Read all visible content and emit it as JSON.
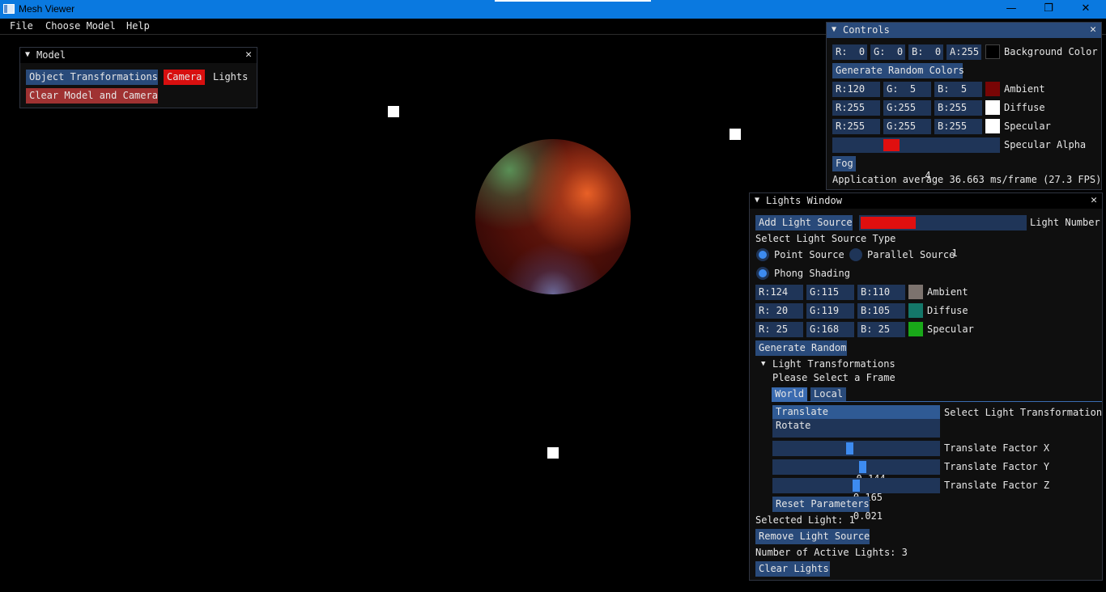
{
  "window": {
    "title": "Mesh Viewer",
    "minimize_glyph": "—",
    "maximize_glyph": "❐",
    "close_glyph": "✕"
  },
  "menu": [
    "File",
    "Choose Model",
    "Help"
  ],
  "model_window": {
    "title": "Model",
    "buttons": {
      "object_transformations": "Object Transformations",
      "camera": "Camera",
      "lights": "Lights",
      "clear": "Clear Model and Camera"
    }
  },
  "controls_window": {
    "title": "Controls",
    "background": {
      "r": "R:  0",
      "g": "G:  0",
      "b": "B:  0",
      "a": "A:255",
      "label": "Background Color",
      "color": "#000000"
    },
    "generate_random_colors": "Generate Random Colors",
    "ambient": {
      "r": "R:120",
      "g": "G:  5",
      "b": "B:  5",
      "label": "Ambient",
      "color": "#780505"
    },
    "diffuse": {
      "r": "R:255",
      "g": "G:255",
      "b": "B:255",
      "label": "Diffuse",
      "color": "#ffffff"
    },
    "specular": {
      "r": "R:255",
      "g": "G:255",
      "b": "B:255",
      "label": "Specular",
      "color": "#ffffff"
    },
    "specular_alpha": {
      "value": "4",
      "label": "Specular Alpha"
    },
    "fog": "Fog",
    "fps": "Application average 36.663 ms/frame (27.3 FPS)"
  },
  "lights_window": {
    "title": "Lights Window",
    "add_light": "Add Light Source",
    "light_number": {
      "value": "1",
      "label": "Light Number"
    },
    "select_type": "Select Light Source Type",
    "point_source": "Point Source",
    "parallel_source": "Parallel Source",
    "phong": "Phong Shading",
    "ambient": {
      "r": "R:124",
      "g": "G:115",
      "b": "B:110",
      "label": "Ambient",
      "color": "#7c736e"
    },
    "diffuse": {
      "r": "R: 20",
      "g": "G:119",
      "b": "B:105",
      "label": "Diffuse",
      "color": "#147769"
    },
    "specular": {
      "r": "R: 25",
      "g": "G:168",
      "b": "B: 25",
      "label": "Specular",
      "color": "#19a819"
    },
    "generate_random": "Generate Random",
    "transformations": {
      "header": "Light Transformations",
      "prompt": "Please Select a Frame",
      "tabs": [
        "World",
        "Local"
      ],
      "list": [
        "Translate",
        "Rotate"
      ],
      "list_label": "Select Light Transformation",
      "factors": [
        {
          "value": "-0.144",
          "label": "Translate Factor X"
        },
        {
          "value": "0.165",
          "label": "Translate Factor Y"
        },
        {
          "value": "0.021",
          "label": "Translate Factor Z"
        }
      ],
      "reset": "Reset Parameters"
    },
    "selected_light": "Selected Light: 1",
    "remove_light": "Remove Light Source",
    "active_lights": "Number of Active Lights: 3",
    "clear_lights": "Clear Lights"
  }
}
